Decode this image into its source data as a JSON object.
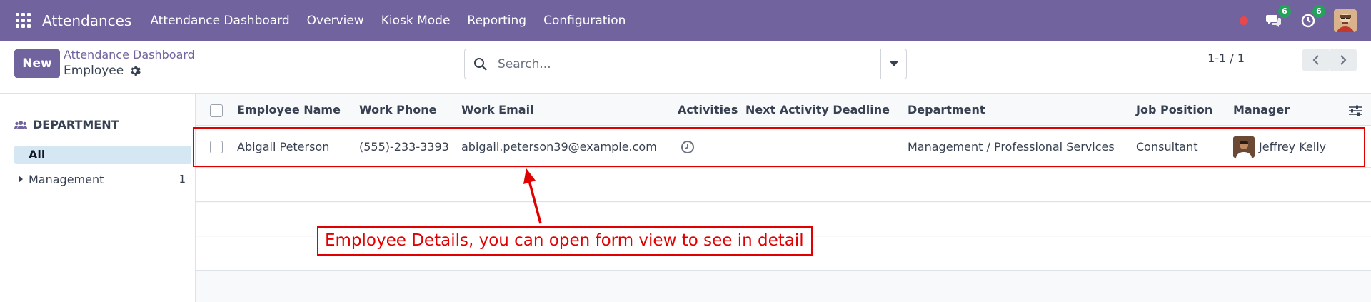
{
  "navbar": {
    "app_name": "Attendances",
    "menu": [
      "Attendance Dashboard",
      "Overview",
      "Kiosk Mode",
      "Reporting",
      "Configuration"
    ],
    "messages_count": "6",
    "activities_count": "6",
    "bg_color": "#71639e"
  },
  "control": {
    "new_label": "New",
    "breadcrumb": "Attendance Dashboard",
    "title": "Employee",
    "search_placeholder": "Search...",
    "pager": "1-1 / 1"
  },
  "sidebar": {
    "heading": "DEPARTMENT",
    "all_label": "All",
    "items": [
      {
        "label": "Management",
        "count": "1"
      }
    ]
  },
  "table": {
    "columns": [
      "Employee Name",
      "Work Phone",
      "Work Email",
      "Activities",
      "Next Activity Deadline",
      "Department",
      "Job Position",
      "Manager"
    ],
    "rows": [
      {
        "name": "Abigail Peterson",
        "phone": "(555)-233-3393",
        "email": "abigail.peterson39@example.com",
        "activities": "clock-icon",
        "deadline": "",
        "department": "Management / Professional Services",
        "job": "Consultant",
        "manager": "Jeffrey Kelly"
      }
    ]
  },
  "annotation": {
    "text": "Employee Details, you can open form view to see in detail",
    "color": "#e00000"
  }
}
